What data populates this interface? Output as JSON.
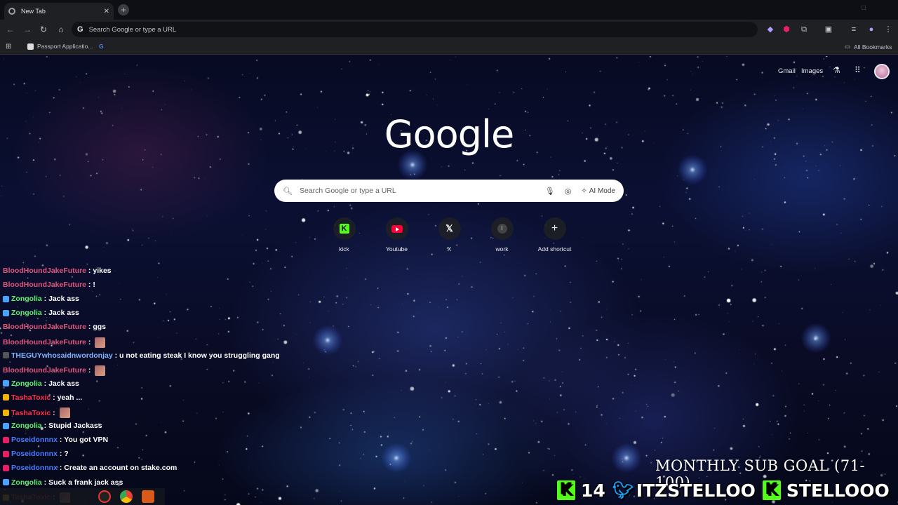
{
  "browser": {
    "tab": {
      "title": "New Tab",
      "close": "✕"
    },
    "new_tab": "+",
    "omnibox": {
      "placeholder": "Search Google or type a URL",
      "g": "G"
    },
    "bookmarks": [
      {
        "label": "Passport Applicatio..."
      },
      {
        "label": ""
      }
    ],
    "all_bookmarks": "All Bookmarks"
  },
  "ntp": {
    "top_links": {
      "gmail": "Gmail",
      "images": "Images"
    },
    "logo": "Google",
    "search": {
      "placeholder": "Search Google or type a URL",
      "ai_mode": "AI Mode"
    },
    "shortcuts": [
      {
        "label": "kick",
        "icon": "kick-icon"
      },
      {
        "label": "Youtube",
        "icon": "youtube-icon"
      },
      {
        "label": "X",
        "icon": "x-icon"
      },
      {
        "label": "work",
        "icon": "work-icon"
      },
      {
        "label": "Add shortcut",
        "icon": "plus-icon"
      }
    ]
  },
  "chat": [
    {
      "user": "BloodHoundJakeFuture",
      "sep": " : ",
      "msg": "yikes",
      "color": "#e0557a",
      "badge": ""
    },
    {
      "user": "BloodHoundJakeFuture",
      "sep": " : ",
      "msg": "!",
      "color": "#e0557a",
      "badge": ""
    },
    {
      "user": "Zongolia",
      "sep": " : ",
      "msg": "Jack ass",
      "color": "#5cf26a",
      "badge": "#4aa3ff"
    },
    {
      "user": "Zongolia",
      "sep": " : ",
      "msg": "Jack ass",
      "color": "#5cf26a",
      "badge": "#4aa3ff"
    },
    {
      "user": "BloodHoundJakeFuture",
      "sep": " : ",
      "msg": "ggs",
      "color": "#e0557a",
      "badge": ""
    },
    {
      "user": "BloodHoundJakeFuture",
      "sep": " : ",
      "msg": "",
      "color": "#e0557a",
      "badge": "",
      "emote": true
    },
    {
      "user": "THEGUYwhosaidnwordonjay",
      "sep": " : ",
      "msg": "u not eating steak I know you struggling gang",
      "color": "#7fb3ff",
      "badge": "#555"
    },
    {
      "user": "BloodHoundJakeFuture",
      "sep": " : ",
      "msg": "",
      "color": "#e0557a",
      "badge": "",
      "emote": true
    },
    {
      "user": "Zongolia",
      "sep": " : ",
      "msg": "Jack ass",
      "color": "#5cf26a",
      "badge": "#4aa3ff"
    },
    {
      "user": "TashaToxic",
      "sep": " : ",
      "msg": "yeah ...",
      "color": "#ff3344",
      "badge": "#f4b400"
    },
    {
      "user": "TashaToxic",
      "sep": " : ",
      "msg": "",
      "color": "#ff3344",
      "badge": "#f4b400",
      "emote": true
    },
    {
      "user": "Zongolia",
      "sep": " : ",
      "msg": "Stupid Jackass",
      "color": "#5cf26a",
      "badge": "#4aa3ff"
    },
    {
      "user": "Poseidonnnx",
      "sep": " : ",
      "msg": "You got VPN",
      "color": "#4a7dff",
      "badge": "#e91e63"
    },
    {
      "user": "Poseidonnnx",
      "sep": " : ",
      "msg": "?",
      "color": "#4a7dff",
      "badge": "#e91e63"
    },
    {
      "user": "Poseidonnnx",
      "sep": " : ",
      "msg": "Create an account on stake.com",
      "color": "#4a7dff",
      "badge": "#e91e63"
    },
    {
      "user": "Zongolia",
      "sep": " : ",
      "msg": "Suck a frank jack ass",
      "color": "#5cf26a",
      "badge": "#4aa3ff"
    },
    {
      "user": "TashaToxic",
      "sep": " : ",
      "msg": "",
      "color": "#ff3344",
      "badge": "#f4b400",
      "emote": true
    }
  ],
  "overlay": {
    "subgoal": "MONTHLY SUB GOAL (71-100)",
    "count": "14",
    "twitter": "ITZSTELLOO",
    "kick": "STELLOOO",
    "k": "K"
  },
  "colors": {
    "accent": "#53fc18",
    "twitter": "#1da1f2"
  }
}
